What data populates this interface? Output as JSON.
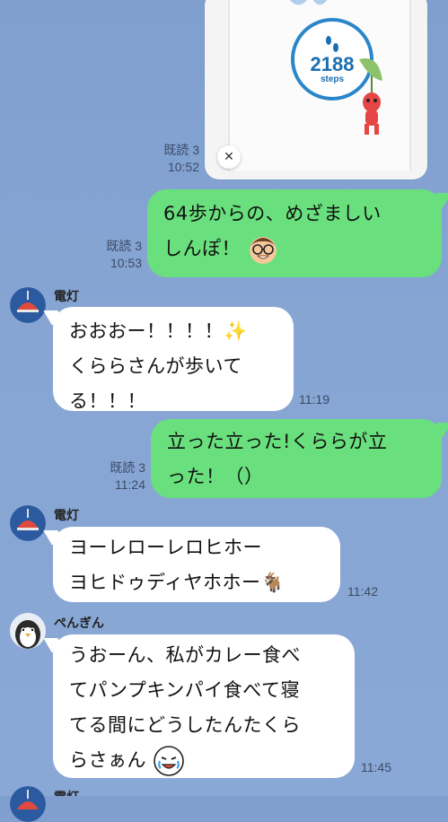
{
  "shared_image": {
    "steps_value": "2188",
    "steps_label": "steps"
  },
  "messages": [
    {
      "side": "out",
      "read": "既読 3",
      "time": "10:52"
    },
    {
      "side": "out",
      "read": "既読 3",
      "time": "10:53",
      "lines": [
        "64歩からの、めざましい",
        "しんぽ！"
      ]
    },
    {
      "side": "in",
      "sender": "電灯",
      "time": "11:19",
      "lines": [
        "おおおー！！！！✨",
        "くららさんが歩いて",
        "る！！！"
      ]
    },
    {
      "side": "out",
      "read": "既読 3",
      "time": "11:24",
      "lines": [
        "立った立った!くららが立",
        "った！（）"
      ]
    },
    {
      "side": "in",
      "sender": "電灯",
      "time": "11:42",
      "lines": [
        "ヨーレローレロヒホー",
        "ヨヒドゥディヤホホー🐐"
      ]
    },
    {
      "side": "in",
      "sender": "ぺんぎん",
      "time": "11:45",
      "lines": [
        "うおーん、私がカレー食べ",
        "てパンプキンパイ食べて寝",
        "てる間にどうしたんたくら",
        "らさぁん"
      ]
    },
    {
      "side": "in",
      "sender": "電灯"
    }
  ],
  "icons": {
    "close": "close-icon",
    "lamp_avatar": "lamp-avatar-icon",
    "penguin_avatar": "penguin-avatar-icon"
  },
  "colors": {
    "background": "#86a5d3",
    "out_bubble": "#69e07d",
    "in_bubble": "#ffffff",
    "ring": "#2a86c9"
  }
}
